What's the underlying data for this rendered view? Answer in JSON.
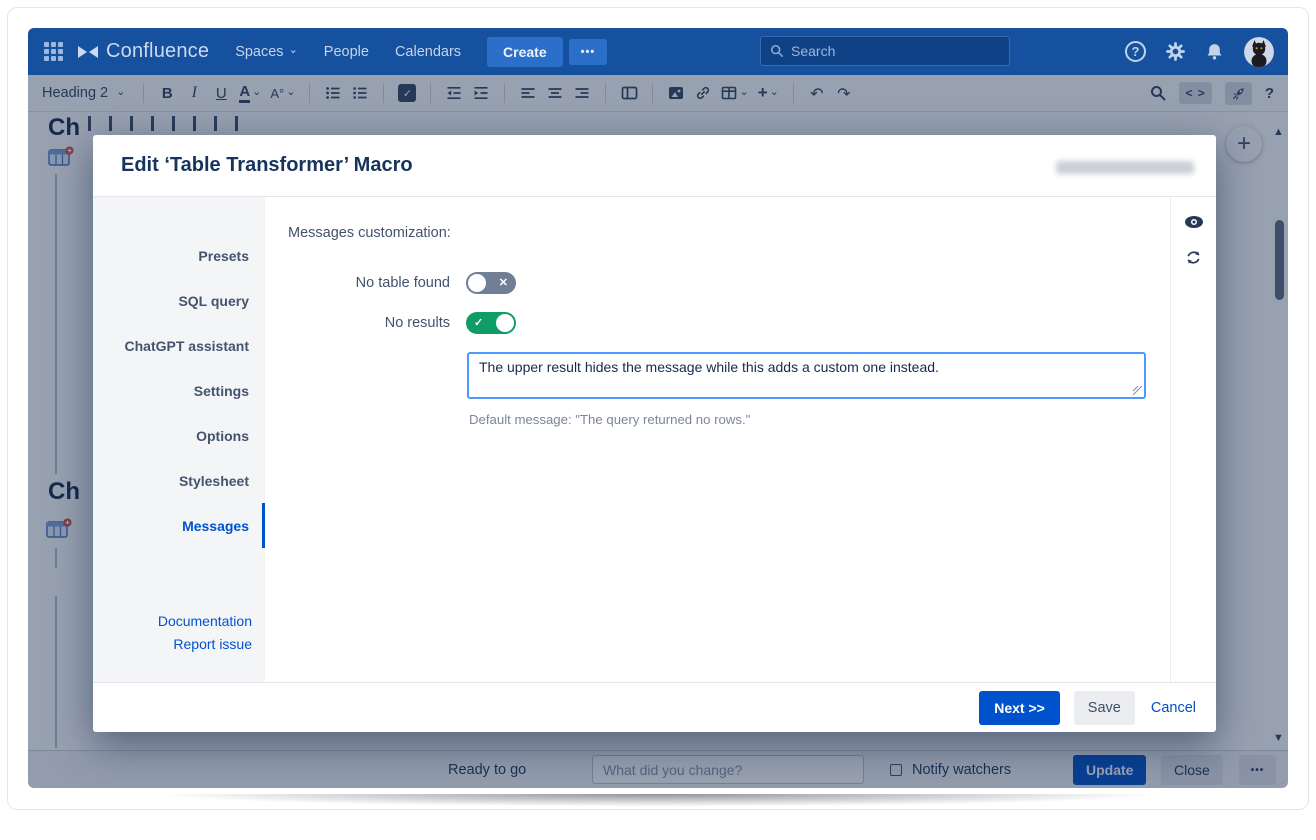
{
  "glyphs": {
    "question": "?",
    "ellipsis": "•••",
    "chevron": "⌄",
    "plus": "+",
    "undo": "↶",
    "redo": "↷",
    "check": "✓",
    "cross": "✕",
    "arrow_up": "▲",
    "arrow_down": "▼"
  },
  "colors": {
    "navbar": "#15519f",
    "accent": "#0052cc",
    "toggle_on": "#0e9d64",
    "toggle_off": "#707e96",
    "overlay": "rgba(21,42,76,0.44)",
    "focus_border": "#4c9aff"
  },
  "icons": {
    "navbar": [
      "app-grid-icon",
      "confluence-mark-icon",
      "chevron-down-icon",
      "search-icon",
      "help-icon",
      "gear-icon",
      "bell-icon",
      "avatar-cat"
    ],
    "toolbar": [
      "bold",
      "italic",
      "underline",
      "text-color",
      "more-formatting",
      "bullet-list",
      "numbered-list",
      "task-list",
      "outdent",
      "indent",
      "align-left",
      "align-center",
      "align-right",
      "page-layout",
      "insert-image",
      "insert-link",
      "insert-table",
      "insert-more",
      "undo",
      "redo",
      "find-replace",
      "source-editor",
      "rocket",
      "help"
    ],
    "modal_rail": [
      "preview-eye",
      "refresh"
    ],
    "page": [
      "plus-fab",
      "scroll-up-arrow",
      "scroll-thumb",
      "scroll-down-arrow",
      "table-macro-icon"
    ]
  },
  "navbar": {
    "product": "Confluence",
    "menu": [
      "Spaces",
      "People",
      "Calendars"
    ],
    "create_label": "Create",
    "search_placeholder": "Search"
  },
  "toolbar": {
    "style": "Heading 2",
    "bold": "B",
    "italic": "I",
    "underline": "U",
    "color_letter": "A",
    "format_letter": "A°",
    "source": "< >"
  },
  "page_bg": {
    "heading1": "Ch",
    "heading2": "Ch"
  },
  "modal": {
    "title": "Edit ‘Table Transformer’ Macro",
    "sidebar": {
      "items": [
        "Presets",
        "SQL query",
        "ChatGPT assistant",
        "Settings",
        "Options",
        "Stylesheet",
        "Messages"
      ],
      "active": "Messages",
      "links": [
        "Documentation",
        "Report issue"
      ]
    },
    "content": {
      "section": "Messages customization:",
      "rows": [
        {
          "label": "No table found",
          "state": "off"
        },
        {
          "label": "No results",
          "state": "on"
        }
      ],
      "message": "The upper result hides the message while this adds a custom one instead.",
      "default_hint": "Default message:  \"The query returned no rows.\""
    },
    "footer": {
      "next": "Next >>",
      "save": "Save",
      "cancel": "Cancel"
    }
  },
  "editor_footer": {
    "status": "Ready to go",
    "comment_placeholder": "What did you change?",
    "notify": "Notify watchers",
    "update": "Update",
    "close": "Close"
  }
}
